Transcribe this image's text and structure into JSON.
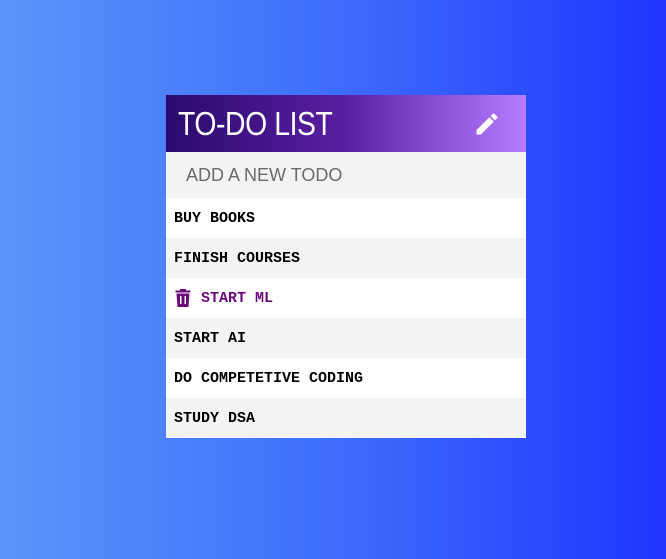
{
  "header": {
    "title": "TO-DO LIST",
    "edit_icon": "pencil-icon"
  },
  "new_todo": {
    "placeholder": "ADD A NEW TODO",
    "value": ""
  },
  "todos": [
    {
      "label": "BUY BOOKS",
      "hovered": false
    },
    {
      "label": "FINISH COURSES",
      "hovered": false
    },
    {
      "label": "START ML",
      "hovered": true
    },
    {
      "label": "START AI",
      "hovered": false
    },
    {
      "label": "DO COMPETETIVE CODING",
      "hovered": false
    },
    {
      "label": "STUDY DSA",
      "hovered": false
    }
  ],
  "colors": {
    "background_start": "#5b95f9",
    "background_end": "#1e36fd",
    "header_start": "#2b0a6b",
    "header_end": "#b77cff",
    "hover_text": "#6a0a78"
  },
  "icons": {
    "delete": "trash-icon"
  }
}
